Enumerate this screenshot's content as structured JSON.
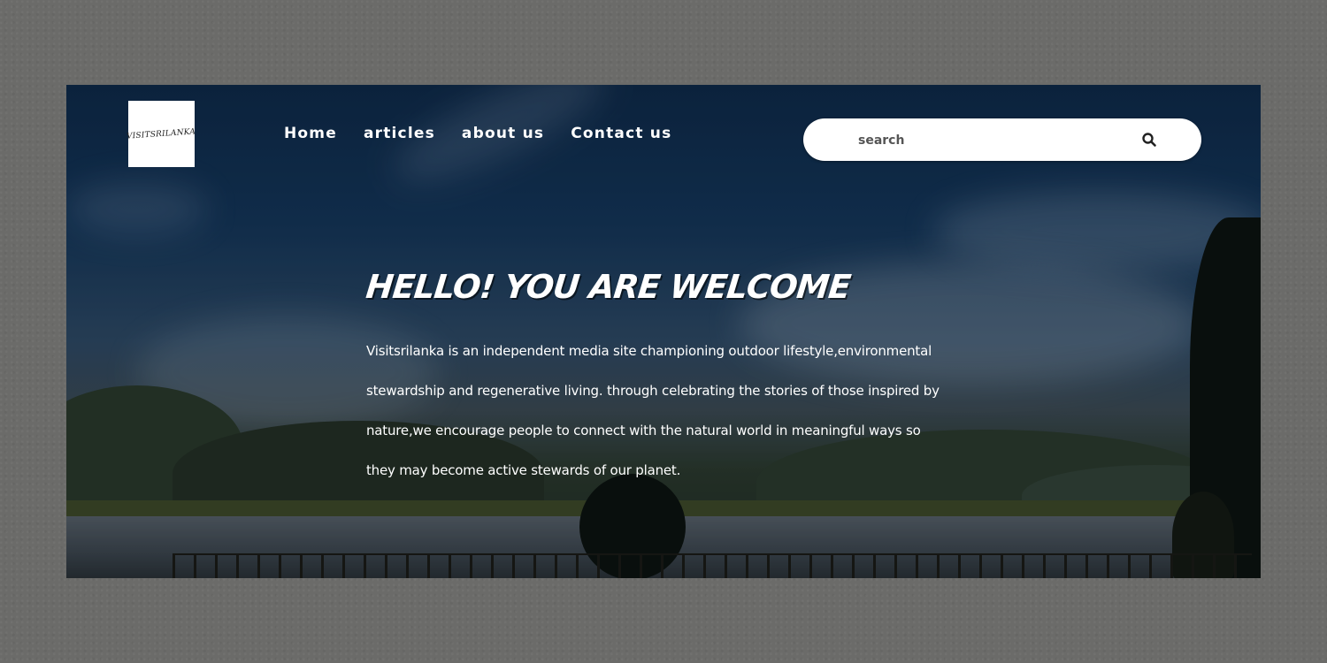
{
  "logo": {
    "text": "VISITSRILANKA"
  },
  "nav": {
    "items": [
      {
        "label": "Home"
      },
      {
        "label": "articles"
      },
      {
        "label": "about us"
      },
      {
        "label": "Contact us"
      }
    ]
  },
  "search": {
    "placeholder": "search",
    "icon": "search-icon"
  },
  "hero": {
    "title": "Hello! you are welcome",
    "paragraph_lines": [
      "Visitsrilanka is an independent media site championing outdoor lifestyle,environmental",
      "stewardship and regenerative living. through celebrating the stories of those inspired by",
      "nature,we encourage people to connect with the natural world in meaningful ways so",
      "they may become active stewards of our planet."
    ]
  },
  "colors": {
    "page_background": "#6b6b69",
    "text": "#ffffff",
    "search_background": "#ffffff"
  }
}
